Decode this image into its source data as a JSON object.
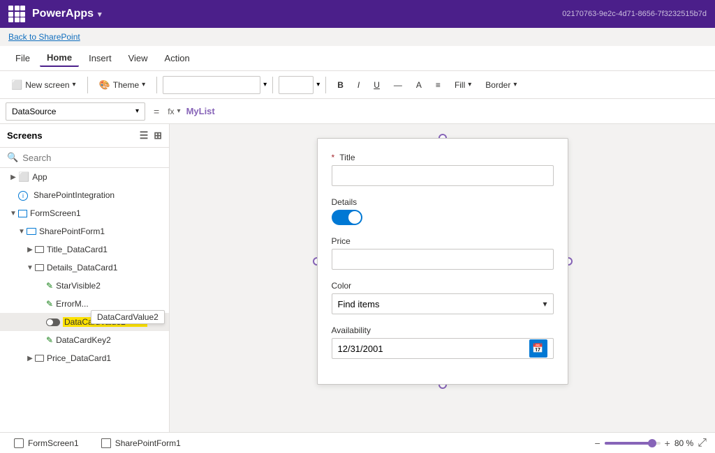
{
  "app": {
    "name": "PowerApps",
    "instance_id": "02170763-9e2c-4d71-8656-7f3232515b7d"
  },
  "back_link": "Back to SharePoint",
  "menu": {
    "items": [
      "File",
      "Home",
      "Insert",
      "View",
      "Action"
    ],
    "active": "Home"
  },
  "toolbar": {
    "new_screen": "New screen",
    "theme": "Theme",
    "bold": "B",
    "fill": "Fill",
    "border": "Border"
  },
  "formula_bar": {
    "source": "DataSource",
    "eq": "=",
    "fx": "fx",
    "value": "MyList"
  },
  "sidebar": {
    "title": "Screens",
    "search_placeholder": "Search",
    "tree": [
      {
        "id": "app",
        "label": "App",
        "type": "app",
        "depth": 0,
        "expanded": false
      },
      {
        "id": "sp-integration",
        "label": "SharePointIntegration",
        "type": "sp",
        "depth": 0,
        "expanded": false
      },
      {
        "id": "form-screen1",
        "label": "FormScreen1",
        "type": "screen",
        "depth": 0,
        "expanded": true
      },
      {
        "id": "sp-form1",
        "label": "SharePointForm1",
        "type": "form",
        "depth": 1,
        "expanded": true
      },
      {
        "id": "title-card",
        "label": "Title_DataCard1",
        "type": "card",
        "depth": 2,
        "expanded": false
      },
      {
        "id": "details-card",
        "label": "Details_DataCard1",
        "type": "card",
        "depth": 2,
        "expanded": true
      },
      {
        "id": "star-visible2",
        "label": "StarVisible2",
        "type": "pencil",
        "depth": 3,
        "expanded": false
      },
      {
        "id": "error-message",
        "label": "ErrorMessage",
        "type": "pencil",
        "depth": 3,
        "expanded": false
      },
      {
        "id": "datacardvalue2",
        "label": "DataCardValue2",
        "type": "toggle",
        "depth": 3,
        "expanded": false,
        "selected": true
      },
      {
        "id": "datacardkey2",
        "label": "DataCardKey2",
        "type": "pencil",
        "depth": 3,
        "expanded": false
      },
      {
        "id": "price-card",
        "label": "Price_DataCard1",
        "type": "card",
        "depth": 2,
        "expanded": false
      }
    ]
  },
  "tooltip": {
    "text": "DataCardValue2"
  },
  "form": {
    "fields": [
      {
        "id": "title",
        "label": "Title",
        "required": true,
        "type": "text",
        "value": ""
      },
      {
        "id": "details",
        "label": "Details",
        "required": false,
        "type": "toggle",
        "value": "on"
      },
      {
        "id": "price",
        "label": "Price",
        "required": false,
        "type": "text",
        "value": ""
      },
      {
        "id": "color",
        "label": "Color",
        "required": false,
        "type": "dropdown",
        "value": "Find items"
      },
      {
        "id": "availability",
        "label": "Availability",
        "required": false,
        "type": "date",
        "value": "12/31/2001"
      }
    ]
  },
  "status_bar": {
    "tabs": [
      {
        "label": "FormScreen1",
        "icon": "screen"
      },
      {
        "label": "SharePointForm1",
        "icon": "form"
      }
    ],
    "zoom_minus": "−",
    "zoom_plus": "+",
    "zoom_level": "80 %"
  }
}
